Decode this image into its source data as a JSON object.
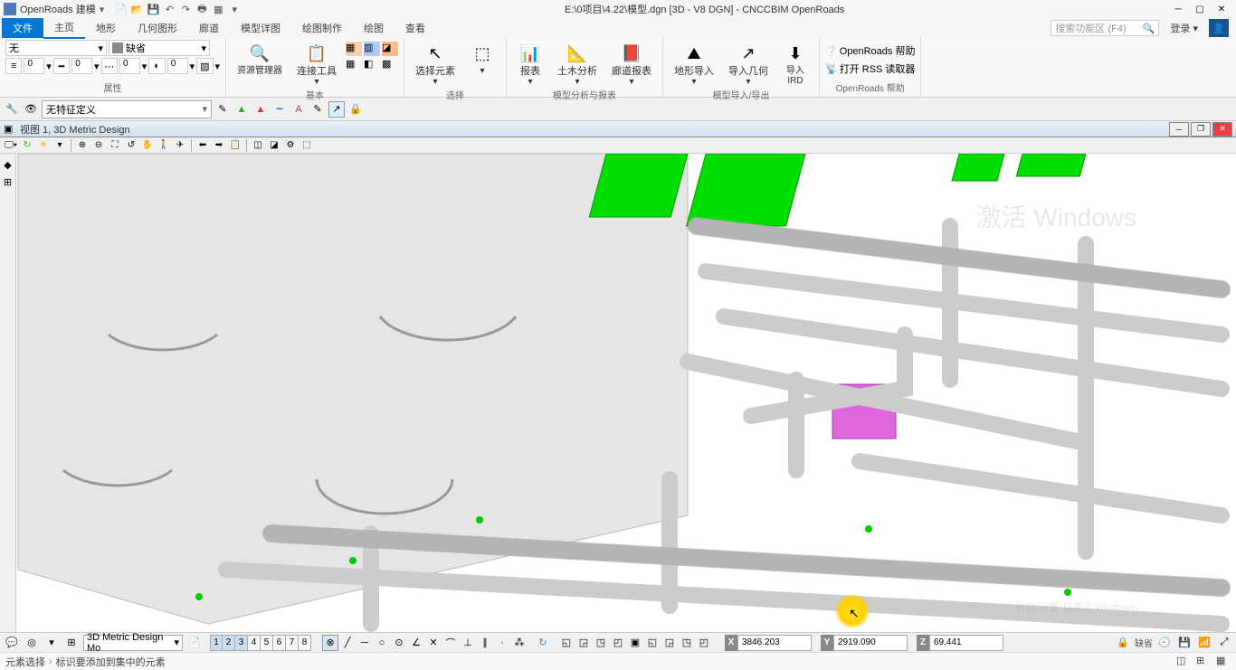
{
  "titlebar": {
    "workflow": "OpenRoads 建模",
    "doc_title": "E:\\0项目\\4.22\\模型.dgn [3D - V8 DGN] - CNCCBIM OpenRoads"
  },
  "ribbon_tabs": {
    "file": "文件",
    "items": [
      "主页",
      "地形",
      "几何图形",
      "廊道",
      "模型详图",
      "绘图制作",
      "绘图",
      "查看"
    ]
  },
  "ribbon_right": {
    "search_placeholder": "搜索功能区 (F4)",
    "login": "登录"
  },
  "ribbon": {
    "attributes": {
      "level_value": "无",
      "default_value": "缺省",
      "num1": "0",
      "num2": "0",
      "num3": "0",
      "num4": "0",
      "group_label": "属性"
    },
    "basic": {
      "explorer": "资源管理器",
      "attach": "连接工具",
      "group_label": "基本"
    },
    "selection": {
      "select_element": "选择元素",
      "group_label": "选择"
    },
    "analysis": {
      "report": "报表",
      "civil_analysis": "土木分析",
      "corridor_report": "廊道报表",
      "group_label": "模型分析与报表"
    },
    "import_export": {
      "terrain_import": "地形导入",
      "geom_import": "导入几何",
      "import_ird": "导入\nIRD",
      "group_label": "模型导入/导出"
    },
    "help": {
      "help_label": "OpenRoads 帮助",
      "rss_label": "打开 RSS 读取器",
      "group_label": "OpenRoads 帮助"
    }
  },
  "secondary": {
    "combo_value": "无特征定义"
  },
  "view": {
    "title": "视图 1, 3D Metric Design"
  },
  "bottom": {
    "model_combo": "3D Metric Design Mo",
    "view_numbers": [
      "1",
      "2",
      "3",
      "4",
      "5",
      "6",
      "7",
      "8"
    ],
    "coords": {
      "x_label": "X",
      "x": "3846.203",
      "y_label": "Y",
      "y": "2919.090",
      "z_label": "Z",
      "z": "69.441"
    },
    "default_text": "缺省"
  },
  "status": {
    "left1": "元素选择",
    "left2": "标识要添加到集中的元素"
  },
  "watermark": {
    "line1": "激活 Windows",
    "line2": "转到\"设置\"以激活 Windows。"
  }
}
